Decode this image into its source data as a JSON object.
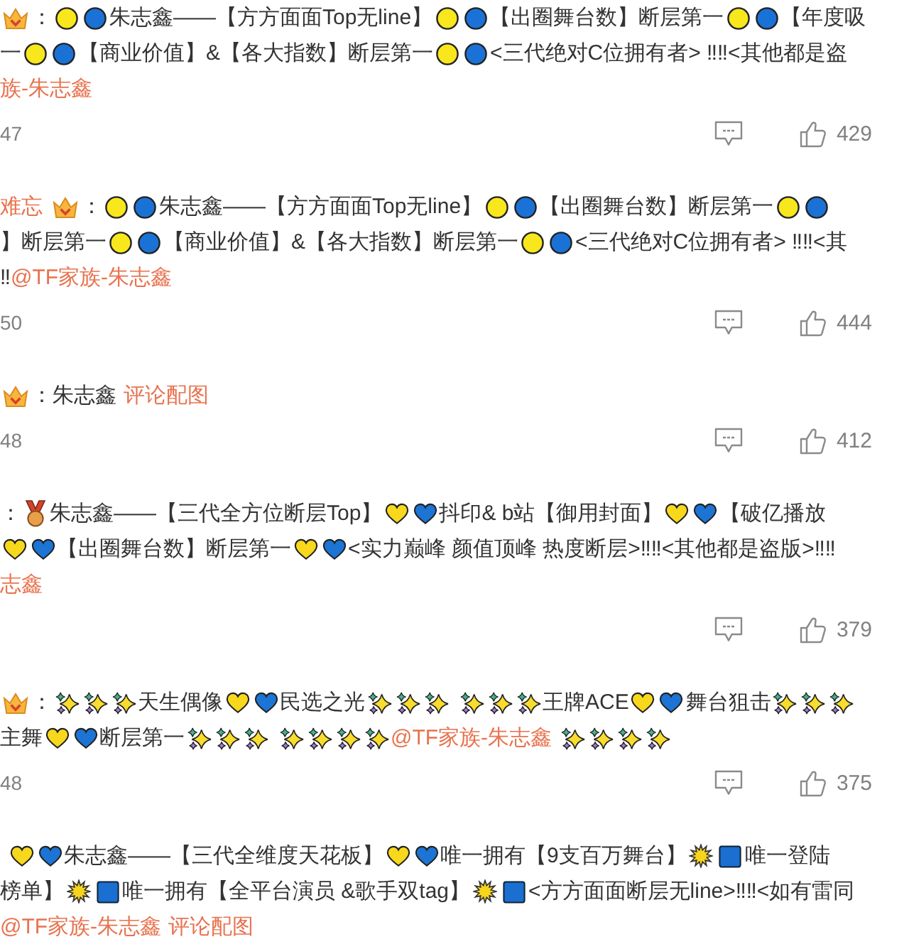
{
  "comments": [
    {
      "lines": [
        [
          {
            "kind": "crown"
          },
          {
            "kind": "text",
            "text": "："
          },
          {
            "kind": "circle",
            "color": "#f8e71c"
          },
          {
            "kind": "circle",
            "color": "#1a72d6"
          },
          {
            "kind": "text",
            "text": "朱志鑫——【方方面面Top无line】"
          },
          {
            "kind": "circle",
            "color": "#f8e71c"
          },
          {
            "kind": "circle",
            "color": "#1a72d6"
          },
          {
            "kind": "text",
            "text": "【出圈舞台数】断层第一"
          },
          {
            "kind": "circle",
            "color": "#f8e71c"
          },
          {
            "kind": "circle",
            "color": "#1a72d6"
          },
          {
            "kind": "text",
            "text": "【年度吸"
          }
        ],
        [
          {
            "kind": "text",
            "text": "一"
          },
          {
            "kind": "circle",
            "color": "#f8e71c"
          },
          {
            "kind": "circle",
            "color": "#1a72d6"
          },
          {
            "kind": "text",
            "text": "【商业价值】&【各大指数】断层第一"
          },
          {
            "kind": "circle",
            "color": "#f8e71c"
          },
          {
            "kind": "circle",
            "color": "#1a72d6"
          },
          {
            "kind": "text",
            "text": "<三代绝对C位拥有者> ‼‼<其他都是盗"
          }
        ],
        [
          {
            "kind": "link",
            "text": "族-朱志鑫"
          }
        ]
      ],
      "time": "47",
      "like_count": "429"
    },
    {
      "lines": [
        [
          {
            "kind": "user",
            "text": "难忘"
          },
          {
            "kind": "space"
          },
          {
            "kind": "crown"
          },
          {
            "kind": "text",
            "text": "："
          },
          {
            "kind": "circle",
            "color": "#f8e71c"
          },
          {
            "kind": "circle",
            "color": "#1a72d6"
          },
          {
            "kind": "text",
            "text": "朱志鑫——【方方面面Top无line】"
          },
          {
            "kind": "circle",
            "color": "#f8e71c"
          },
          {
            "kind": "circle",
            "color": "#1a72d6"
          },
          {
            "kind": "text",
            "text": "【出圈舞台数】断层第一"
          },
          {
            "kind": "circle",
            "color": "#f8e71c"
          },
          {
            "kind": "circle",
            "color": "#1a72d6"
          }
        ],
        [
          {
            "kind": "text",
            "text": "】断层第一"
          },
          {
            "kind": "circle",
            "color": "#f8e71c"
          },
          {
            "kind": "circle",
            "color": "#1a72d6"
          },
          {
            "kind": "text",
            "text": "【商业价值】&【各大指数】断层第一"
          },
          {
            "kind": "circle",
            "color": "#f8e71c"
          },
          {
            "kind": "circle",
            "color": "#1a72d6"
          },
          {
            "kind": "text",
            "text": "<三代绝对C位拥有者> ‼‼<其"
          }
        ],
        [
          {
            "kind": "text",
            "text": "‼"
          },
          {
            "kind": "link",
            "text": "@TF家族-朱志鑫"
          }
        ]
      ],
      "time": "50",
      "like_count": "444"
    },
    {
      "lines": [
        [
          {
            "kind": "crown"
          },
          {
            "kind": "text",
            "text": "：朱志鑫"
          },
          {
            "kind": "space"
          },
          {
            "kind": "link",
            "text": "评论配图"
          }
        ]
      ],
      "time": "48",
      "like_count": "412"
    },
    {
      "lines": [
        [
          {
            "kind": "text",
            "text": "："
          },
          {
            "kind": "medal"
          },
          {
            "kind": "text",
            "text": "朱志鑫——【三代全方位断层Top】"
          },
          {
            "kind": "heart",
            "color": "#f8d81c"
          },
          {
            "kind": "heart",
            "color": "#1c74d4"
          },
          {
            "kind": "text",
            "text": "抖印& b站【御用封面】"
          },
          {
            "kind": "heart",
            "color": "#f8d81c"
          },
          {
            "kind": "heart",
            "color": "#1c74d4"
          },
          {
            "kind": "text",
            "text": "【破亿播放"
          }
        ],
        [
          {
            "kind": "heart",
            "color": "#f8d81c"
          },
          {
            "kind": "heart",
            "color": "#1c74d4"
          },
          {
            "kind": "text",
            "text": "【出圈舞台数】断层第一"
          },
          {
            "kind": "heart",
            "color": "#f8d81c"
          },
          {
            "kind": "heart",
            "color": "#1c74d4"
          },
          {
            "kind": "text",
            "text": "<实力巅峰 颜值顶峰 热度断层>‼‼<其他都是盗版>‼‼"
          }
        ],
        [
          {
            "kind": "link",
            "text": "志鑫"
          }
        ]
      ],
      "like_count": "379"
    },
    {
      "lines": [
        [
          {
            "kind": "crown"
          },
          {
            "kind": "text",
            "text": "："
          },
          {
            "kind": "sparkles"
          },
          {
            "kind": "sparkles"
          },
          {
            "kind": "sparkles"
          },
          {
            "kind": "text",
            "text": "天生偶像"
          },
          {
            "kind": "heart",
            "color": "#f8d81c"
          },
          {
            "kind": "heart",
            "color": "#1c74d4"
          },
          {
            "kind": "text",
            "text": "民选之光"
          },
          {
            "kind": "sparkles"
          },
          {
            "kind": "sparkles"
          },
          {
            "kind": "sparkles"
          },
          {
            "kind": "space"
          },
          {
            "kind": "sparkles"
          },
          {
            "kind": "sparkles"
          },
          {
            "kind": "sparkles"
          },
          {
            "kind": "text",
            "text": "王牌ACE"
          },
          {
            "kind": "heart",
            "color": "#f8d81c"
          },
          {
            "kind": "heart",
            "color": "#1c74d4"
          },
          {
            "kind": "text",
            "text": "舞台狙击"
          },
          {
            "kind": "sparkles"
          },
          {
            "kind": "sparkles"
          },
          {
            "kind": "sparkles"
          }
        ],
        [
          {
            "kind": "text",
            "text": "主舞"
          },
          {
            "kind": "heart",
            "color": "#f8d81c"
          },
          {
            "kind": "heart",
            "color": "#1c74d4"
          },
          {
            "kind": "text",
            "text": "断层第一"
          },
          {
            "kind": "sparkles"
          },
          {
            "kind": "sparkles"
          },
          {
            "kind": "sparkles"
          },
          {
            "kind": "space"
          },
          {
            "kind": "sparkles"
          },
          {
            "kind": "sparkles"
          },
          {
            "kind": "sparkles"
          },
          {
            "kind": "sparkles"
          },
          {
            "kind": "link",
            "text": "@TF家族-朱志鑫"
          },
          {
            "kind": "space"
          },
          {
            "kind": "sparkles"
          },
          {
            "kind": "sparkles"
          },
          {
            "kind": "sparkles"
          },
          {
            "kind": "sparkles"
          }
        ]
      ],
      "time": "48",
      "like_count": "375"
    },
    {
      "lines": [
        [
          {
            "kind": "space"
          },
          {
            "kind": "heart",
            "color": "#f8d81c"
          },
          {
            "kind": "heart",
            "color": "#1c74d4"
          },
          {
            "kind": "text",
            "text": "朱志鑫——【三代全维度天花板】"
          },
          {
            "kind": "heart",
            "color": "#f8d81c"
          },
          {
            "kind": "heart",
            "color": "#1c74d4"
          },
          {
            "kind": "text",
            "text": "唯一拥有【9支百万舞台】"
          },
          {
            "kind": "starburst"
          },
          {
            "kind": "square"
          },
          {
            "kind": "text",
            "text": "唯一登陆"
          }
        ],
        [
          {
            "kind": "text",
            "text": "榜单】"
          },
          {
            "kind": "starburst"
          },
          {
            "kind": "square"
          },
          {
            "kind": "text",
            "text": "唯一拥有【全平台演员 &歌手双tag】"
          },
          {
            "kind": "starburst"
          },
          {
            "kind": "square"
          },
          {
            "kind": "text",
            "text": "<方方面面断层无line>‼‼<如有雷同"
          }
        ],
        [
          {
            "kind": "link",
            "text": "@TF家族-朱志鑫"
          },
          {
            "kind": "space"
          },
          {
            "kind": "link",
            "text": "评论配图"
          }
        ]
      ]
    }
  ]
}
